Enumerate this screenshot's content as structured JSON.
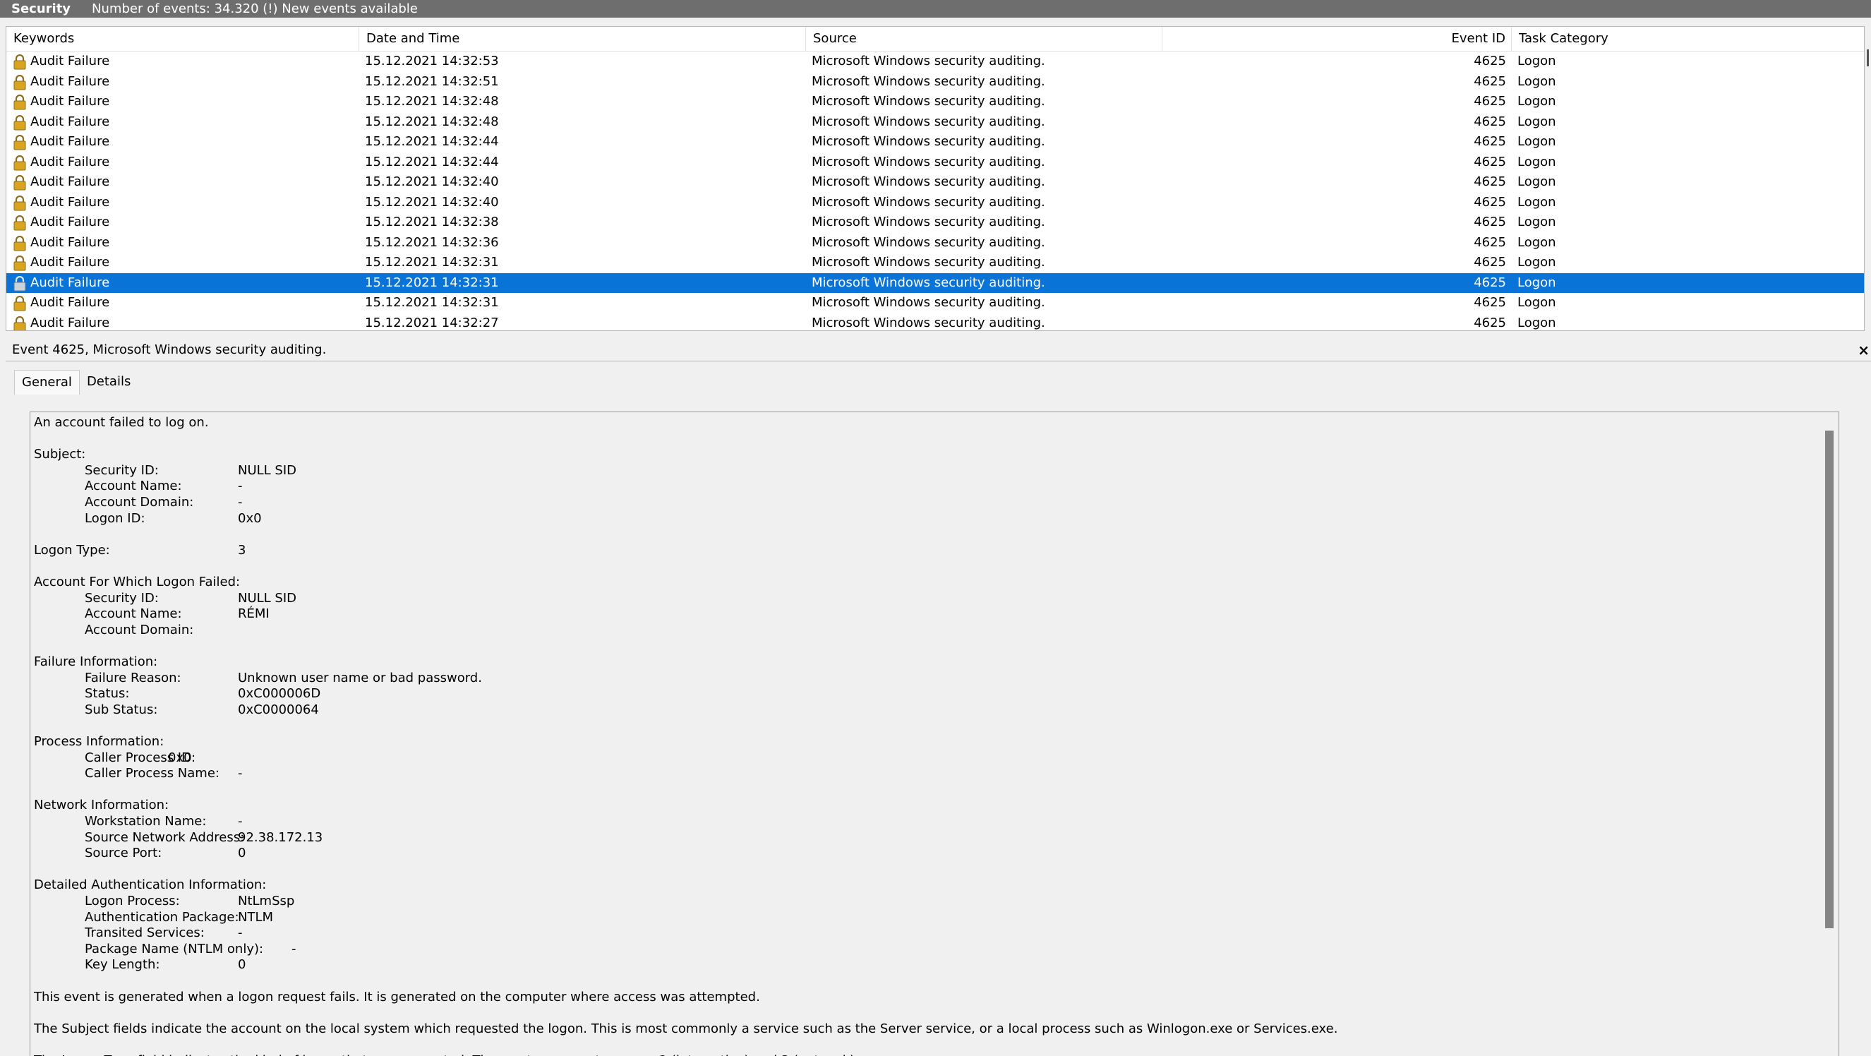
{
  "window": {
    "title": "Security",
    "status": "Number of events: 34.320 (!) New events available"
  },
  "list": {
    "columns": {
      "keywords": "Keywords",
      "datetime": "Date and Time",
      "source": "Source",
      "event_id": "Event ID",
      "task_category": "Task Category"
    },
    "rows": [
      {
        "keyword": "Audit Failure",
        "datetime": "15.12.2021 14:32:53",
        "source": "Microsoft Windows security auditing.",
        "event_id": "4625",
        "task": "Logon"
      },
      {
        "keyword": "Audit Failure",
        "datetime": "15.12.2021 14:32:51",
        "source": "Microsoft Windows security auditing.",
        "event_id": "4625",
        "task": "Logon"
      },
      {
        "keyword": "Audit Failure",
        "datetime": "15.12.2021 14:32:48",
        "source": "Microsoft Windows security auditing.",
        "event_id": "4625",
        "task": "Logon"
      },
      {
        "keyword": "Audit Failure",
        "datetime": "15.12.2021 14:32:48",
        "source": "Microsoft Windows security auditing.",
        "event_id": "4625",
        "task": "Logon"
      },
      {
        "keyword": "Audit Failure",
        "datetime": "15.12.2021 14:32:44",
        "source": "Microsoft Windows security auditing.",
        "event_id": "4625",
        "task": "Logon"
      },
      {
        "keyword": "Audit Failure",
        "datetime": "15.12.2021 14:32:44",
        "source": "Microsoft Windows security auditing.",
        "event_id": "4625",
        "task": "Logon"
      },
      {
        "keyword": "Audit Failure",
        "datetime": "15.12.2021 14:32:40",
        "source": "Microsoft Windows security auditing.",
        "event_id": "4625",
        "task": "Logon"
      },
      {
        "keyword": "Audit Failure",
        "datetime": "15.12.2021 14:32:40",
        "source": "Microsoft Windows security auditing.",
        "event_id": "4625",
        "task": "Logon"
      },
      {
        "keyword": "Audit Failure",
        "datetime": "15.12.2021 14:32:38",
        "source": "Microsoft Windows security auditing.",
        "event_id": "4625",
        "task": "Logon"
      },
      {
        "keyword": "Audit Failure",
        "datetime": "15.12.2021 14:32:36",
        "source": "Microsoft Windows security auditing.",
        "event_id": "4625",
        "task": "Logon"
      },
      {
        "keyword": "Audit Failure",
        "datetime": "15.12.2021 14:32:31",
        "source": "Microsoft Windows security auditing.",
        "event_id": "4625",
        "task": "Logon"
      },
      {
        "keyword": "Audit Failure",
        "datetime": "15.12.2021 14:32:31",
        "source": "Microsoft Windows security auditing.",
        "event_id": "4625",
        "task": "Logon"
      },
      {
        "keyword": "Audit Failure",
        "datetime": "15.12.2021 14:32:31",
        "source": "Microsoft Windows security auditing.",
        "event_id": "4625",
        "task": "Logon"
      },
      {
        "keyword": "Audit Failure",
        "datetime": "15.12.2021 14:32:27",
        "source": "Microsoft Windows security auditing.",
        "event_id": "4625",
        "task": "Logon"
      }
    ],
    "selected_row": 11
  },
  "detail": {
    "title": "Event 4625, Microsoft Windows security auditing.",
    "close": "×",
    "tabs": [
      "General",
      "Details"
    ],
    "lines": [
      {
        "text": "An account failed to log on."
      },
      {
        "text": ""
      },
      {
        "text": "Subject:"
      },
      {
        "label": "Security ID:",
        "value": "NULL SID"
      },
      {
        "label": "Account Name:",
        "value": "-"
      },
      {
        "label": "Account Domain:",
        "value": "-"
      },
      {
        "label": "Logon ID:",
        "value": "0x0"
      },
      {
        "text": ""
      },
      {
        "text": "Logon Type:",
        "value": "3"
      },
      {
        "text": ""
      },
      {
        "text": "Account For Which Logon Failed:"
      },
      {
        "label": "Security ID:",
        "value": "NULL SID"
      },
      {
        "label": "Account Name:",
        "value": "RÉMI"
      },
      {
        "label": "Account Domain:",
        "value": ""
      },
      {
        "text": ""
      },
      {
        "text": "Failure Information:"
      },
      {
        "label": "Failure Reason:",
        "value": "Unknown user name or bad password."
      },
      {
        "label": "Status:",
        "value": "0xC000006D"
      },
      {
        "label": "Sub Status:",
        "value": "0xC0000064"
      },
      {
        "text": ""
      },
      {
        "text": "Process Information:"
      },
      {
        "label": "Caller Process ID:",
        "inline": "0x0"
      },
      {
        "label": "Caller Process Name:",
        "value": "-"
      },
      {
        "text": ""
      },
      {
        "text": "Network Information:"
      },
      {
        "label": "Workstation Name:",
        "value": "-"
      },
      {
        "label": "Source Network Address:",
        "value": "92.38.172.13"
      },
      {
        "label": "Source Port:",
        "value": "0"
      },
      {
        "text": ""
      },
      {
        "text": "Detailed Authentication Information:"
      },
      {
        "label": "Logon Process:",
        "value": "NtLmSsp"
      },
      {
        "label": "Authentication Package:",
        "value": "NTLM"
      },
      {
        "label": "Transited Services:",
        "value": "-"
      },
      {
        "label": "Package Name (NTLM only):",
        "value2": "-"
      },
      {
        "label": "Key Length:",
        "value": "0"
      },
      {
        "text": ""
      },
      {
        "text": "This event is generated when a logon request fails. It is generated on the computer where access was attempted."
      },
      {
        "text": ""
      },
      {
        "text": "The Subject fields indicate the account on the local system which requested the logon. This is most commonly a service such as the Server service, or a local process such as Winlogon.exe or Services.exe."
      },
      {
        "text": ""
      },
      {
        "text": "The Logon Type field indicates the kind of logon that was requested. The most common types are 2 (interactive) and 3 (network)."
      }
    ]
  },
  "colors": {
    "titlebar": "#6e6e6e",
    "selected": "#0a73d8",
    "lock_gold": "#d9a520"
  }
}
